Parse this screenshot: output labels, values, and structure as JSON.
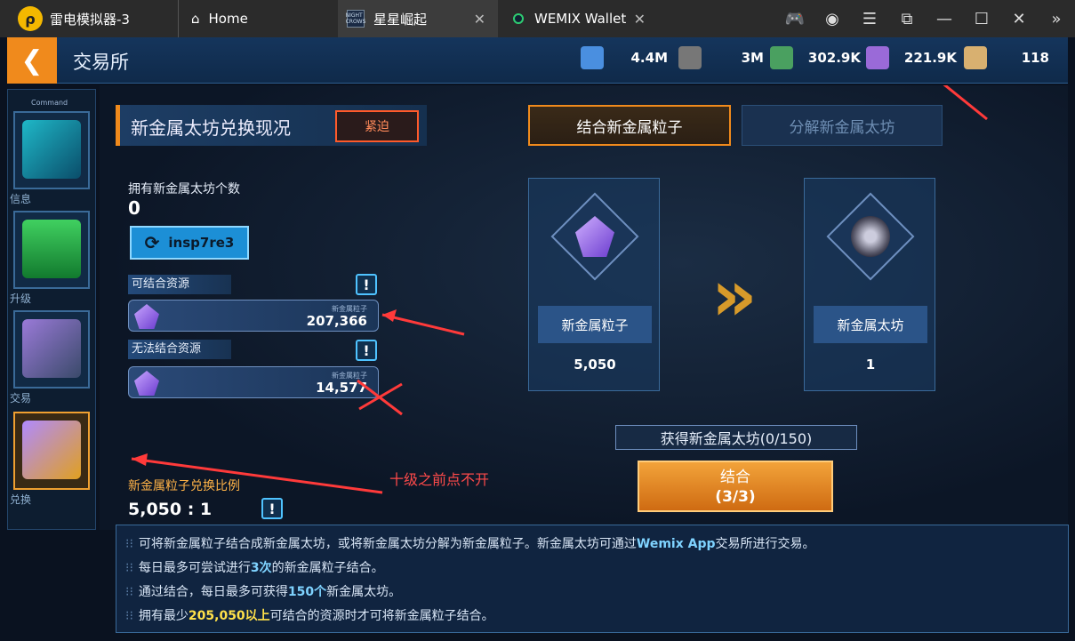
{
  "titlebar": {
    "app_name": "雷电模拟器-3",
    "tabs": [
      {
        "label": "Home"
      },
      {
        "label": "星星崛起"
      },
      {
        "label": "WEMIX Wallet"
      }
    ],
    "game_icon_text": "NIGHT CROWS"
  },
  "header": {
    "back": "❮",
    "title": "交易所",
    "resources": [
      {
        "value": "4.4M",
        "color": "#4a8fe0"
      },
      {
        "value": "3M",
        "color": "#888888"
      },
      {
        "value": "302.9K",
        "color": "#4aa060"
      },
      {
        "value": "221.9K",
        "color": "#9a6ad8"
      },
      {
        "value": "118",
        "color": "#d8b070"
      }
    ]
  },
  "rail": {
    "header": "Command",
    "items": [
      {
        "label": "信息"
      },
      {
        "label": "升级"
      },
      {
        "label": "交易"
      },
      {
        "label": "兑换"
      }
    ]
  },
  "left": {
    "section_title": "新金属太坊兑换现况",
    "urgent": "紧迫",
    "owned_label": "拥有新金属太坊个数",
    "owned_value": "0",
    "id_button": "insp7re3",
    "combinable_label": "可结合资源",
    "combinable_sub": "新金属粒子",
    "combinable_value": "207,366",
    "uncombinable_label": "无法结合资源",
    "uncombinable_sub": "新金属粒子",
    "uncombinable_value": "14,577",
    "ratio_label": "新金属粒子兑换比例",
    "ratio_value": "5,050 : 1",
    "info": "!"
  },
  "right": {
    "tab_combine": "结合新金属粒子",
    "tab_split": "分解新金属太坊",
    "from_name": "新金属粒子",
    "from_count": "5,050",
    "to_name": "新金属太坊",
    "to_count": "1",
    "obtain": "获得新金属太坊(0/150)",
    "combine_label": "结合",
    "combine_count": "(3/3)"
  },
  "notes": [
    {
      "text": "可将新金属粒子结合成新金属太坊，或将新金属太坊分解为新金属粒子。新金属太坊可通过",
      "hl": "Wemix App",
      "rest": "交易所进行交易。"
    },
    {
      "text": "每日最多可尝试进行",
      "hl": "3次",
      "rest": "的新金属粒子结合。"
    },
    {
      "text": "通过结合，每日最多可获得",
      "hl": "150个",
      "rest": "新金属太坊。"
    },
    {
      "text": "拥有最少",
      "hl": "205,050以上",
      "rest": "可结合的资源时才可将新金属粒子结合。"
    }
  ],
  "annotation": {
    "note": "十级之前点不开"
  }
}
